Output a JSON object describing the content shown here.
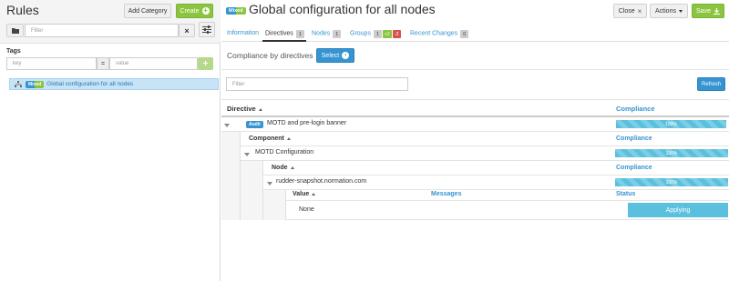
{
  "left_panel": {
    "title": "Rules",
    "add_category_label": "Add Category",
    "create_label": "Create",
    "filter_placeholder": "Filter",
    "tags_title": "Tags",
    "key_placeholder": "key",
    "equals": "=",
    "value_placeholder": "value",
    "add_symbol": "+",
    "tree_item": {
      "badge": "Mixed",
      "label": "Global configuration for all nodes"
    }
  },
  "header": {
    "badge": "Mixed",
    "title": "Global configuration for all nodes",
    "close_label": "Close",
    "actions_label": "Actions",
    "save_label": "Save"
  },
  "tabs": [
    {
      "label": "Information"
    },
    {
      "label": "Directives",
      "badge": "1"
    },
    {
      "label": "Nodes",
      "badge": "1"
    },
    {
      "label": "Groups",
      "badges": [
        "1",
        "+2",
        "-2"
      ]
    },
    {
      "label": "Recent Changes",
      "badge": "0"
    }
  ],
  "compliance": {
    "title": "Compliance by directives",
    "select_label": "Select",
    "filter_placeholder": "Filter",
    "refresh_label": "Refresh"
  },
  "table": {
    "directive_header": "Directive",
    "compliance_header": "Compliance",
    "directive": {
      "badge": "Audit",
      "name": "MOTD and pre-login banner",
      "compliance": "100%"
    },
    "component_header": "Component",
    "component": {
      "name": "MOTD Configuration",
      "compliance": "100%"
    },
    "node_header": "Node",
    "node": {
      "name": "rudder-snapshot.normation.com",
      "compliance": "100%"
    },
    "value_header": "Value",
    "messages_header": "Messages",
    "status_header": "Status",
    "value": {
      "value": "None",
      "message": "",
      "status": "Applying"
    }
  },
  "colors": {
    "primary": "#3694d1",
    "success": "#8bc53f",
    "info": "#5bc0de"
  },
  "icons": [
    "folder-icon",
    "clear-icon",
    "settings-sliders-icon",
    "plus-circle-icon",
    "close-icon",
    "caret-down-icon",
    "download-icon",
    "tree-node-icon"
  ]
}
